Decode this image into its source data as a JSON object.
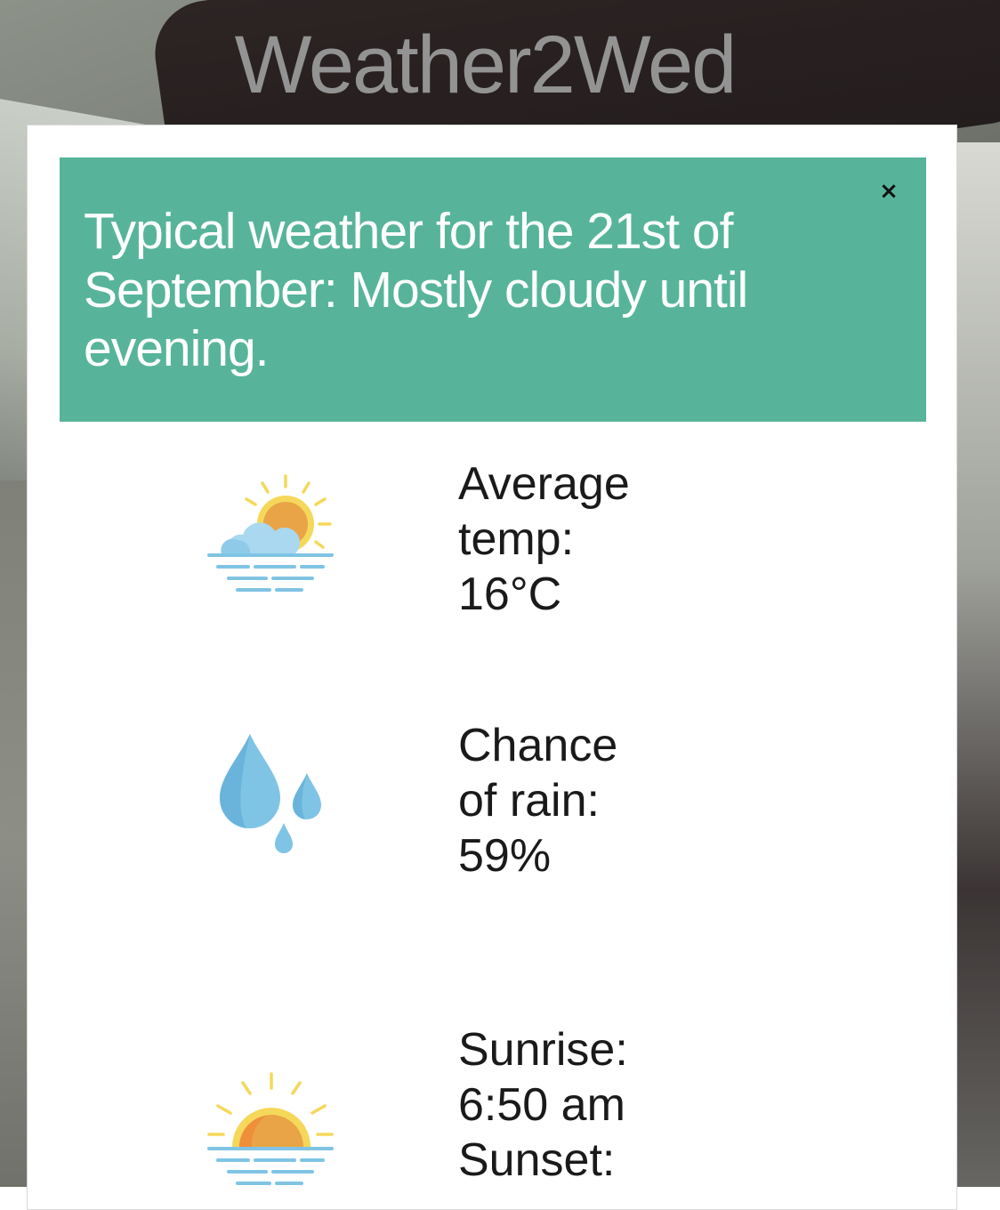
{
  "app": {
    "title": "Weather2Wed"
  },
  "alert": {
    "message": "Typical weather for the 21st of September: Mostly cloudy until evening.",
    "close_symbol": "×"
  },
  "stats": [
    {
      "icon": "partly-cloudy-sun-icon",
      "line1": "Average",
      "line2": "temp:",
      "line3": "16°C"
    },
    {
      "icon": "rain-drops-icon",
      "line1": "Chance",
      "line2": "of rain:",
      "line3": "59%"
    },
    {
      "icon": "sunrise-icon",
      "line1": "Sunrise:",
      "line2": "6:50 am",
      "line3": "Sunset:"
    }
  ],
  "colors": {
    "banner": "#57b49a",
    "title": "#9a9a9a",
    "sun_orange": "#e9a447",
    "sun_yellow": "#f5d85a",
    "water_blue": "#7fc4e4"
  }
}
